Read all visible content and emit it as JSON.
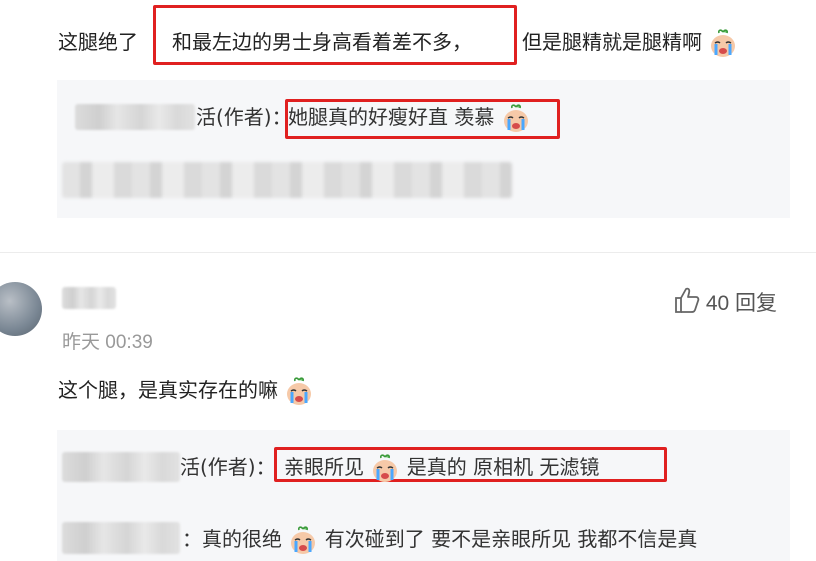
{
  "comment1": {
    "text_prefix": "这腿绝了",
    "text_highlight": "和最左边的男士身高看着差不多，",
    "text_suffix": "但是腿精就是腿精啊",
    "emoji": "crying-face-emoji",
    "reply1": {
      "author_suffix": "活(作者)：",
      "highlight": "她腿真的好瘦好直 羡慕",
      "emoji": "crying-face-emoji"
    }
  },
  "comment2": {
    "time": "昨天 00:39",
    "likes": "40",
    "reply_label": "回复",
    "text": "这个腿，是真实存在的嘛",
    "emoji": "crying-face-emoji",
    "reply1": {
      "author_suffix": "活(作者)：",
      "highlight_a": "亲眼所见",
      "highlight_b": "是真的 原相机 无滤镜",
      "emoji": "crying-face-emoji"
    },
    "reply2": {
      "prefix": "：真的很绝",
      "text": "有次碰到了 要不是亲眼所见 我都不信是真",
      "emoji": "crying-face-emoji"
    }
  },
  "colors": {
    "highlight_border": "#e02020",
    "reply_background": "#f6f7f9"
  }
}
